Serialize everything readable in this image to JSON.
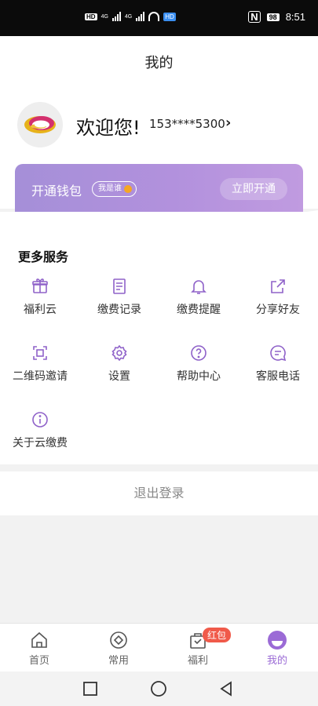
{
  "status_bar": {
    "hd_label": "HD",
    "signal_labels": [
      "4G",
      "4G"
    ],
    "hd2_label": "HD",
    "battery": "98",
    "time": "8:51"
  },
  "header": {
    "title": "我的"
  },
  "user": {
    "welcome": "欢迎您!",
    "phone": "153****5300",
    "arrow": "›"
  },
  "wallet": {
    "title": "开通钱包",
    "badge": "我是谁",
    "button": "立即开通"
  },
  "services": {
    "title": "更多服务",
    "items": [
      {
        "label": "福利云",
        "icon": "gift-icon"
      },
      {
        "label": "缴费记录",
        "icon": "receipt-icon"
      },
      {
        "label": "缴费提醒",
        "icon": "bell-icon"
      },
      {
        "label": "分享好友",
        "icon": "share-icon"
      },
      {
        "label": "二维码邀请",
        "icon": "qr-scan-icon"
      },
      {
        "label": "设置",
        "icon": "gear-icon"
      },
      {
        "label": "帮助中心",
        "icon": "help-icon"
      },
      {
        "label": "客服电话",
        "icon": "chat-icon"
      },
      {
        "label": "关于云缴费",
        "icon": "info-icon"
      }
    ]
  },
  "logout": {
    "label": "退出登录"
  },
  "tabs": [
    {
      "label": "首页",
      "icon": "home-icon"
    },
    {
      "label": "常用",
      "icon": "diamond-icon"
    },
    {
      "label": "福利",
      "icon": "bag-icon",
      "badge": "红包"
    },
    {
      "label": "我的",
      "icon": "profile-icon",
      "active": true
    }
  ],
  "colors": {
    "accent": "#9b6bd6",
    "wallet": "#b291dd",
    "badge": "#f05a4a"
  }
}
